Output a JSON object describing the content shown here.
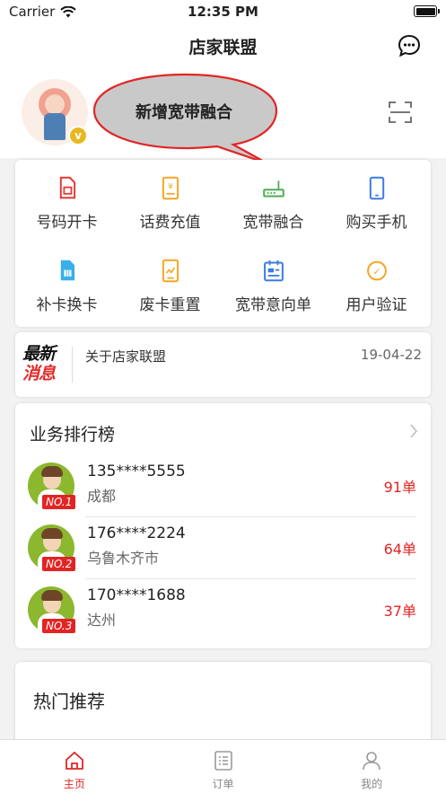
{
  "status_bar": {
    "carrier": "Carrier",
    "time": "12:35 PM"
  },
  "nav": {
    "title": "店家联盟"
  },
  "header": {
    "vip_badge": "v",
    "bubble_text": "新增宽带融合"
  },
  "grid": {
    "items": [
      {
        "label": "号码开卡",
        "icon": "sim-card-icon",
        "color": "#e53935"
      },
      {
        "label": "话费充值",
        "icon": "phone-bill-icon",
        "color": "#f5a623"
      },
      {
        "label": "宽带融合",
        "icon": "router-icon",
        "color": "#4caf50"
      },
      {
        "label": "购买手机",
        "icon": "mobile-phone-icon",
        "color": "#3d7be0"
      },
      {
        "label": "补卡换卡",
        "icon": "sim-replace-icon",
        "color": "#3ab0e8"
      },
      {
        "label": "废卡重置",
        "icon": "card-reset-icon",
        "color": "#f5a623"
      },
      {
        "label": "宽带意向单",
        "icon": "form-icon",
        "color": "#3d7be0"
      },
      {
        "label": "用户验证",
        "icon": "verify-icon",
        "color": "#f5a623"
      }
    ]
  },
  "news": {
    "logo_line1": "最新",
    "logo_line2": "消息",
    "text": "关于店家联盟",
    "date": "19-04-22"
  },
  "ranking": {
    "title": "业务排行榜",
    "rows": [
      {
        "phone": "135****5555",
        "city": "成都",
        "count": "91单",
        "tag": "NO.1"
      },
      {
        "phone": "176****2224",
        "city": "乌鲁木齐市",
        "count": "64单",
        "tag": "NO.2"
      },
      {
        "phone": "170****1688",
        "city": "达州",
        "count": "37单",
        "tag": "NO.3"
      }
    ]
  },
  "hot": {
    "title": "热门推荐"
  },
  "tabs": [
    {
      "label": "主页",
      "icon": "home-icon",
      "active": true
    },
    {
      "label": "订单",
      "icon": "order-list-icon",
      "active": false
    },
    {
      "label": "我的",
      "icon": "user-icon",
      "active": false
    }
  ],
  "colors": {
    "accent": "#e32424",
    "bubble": "#c9c9c9"
  }
}
